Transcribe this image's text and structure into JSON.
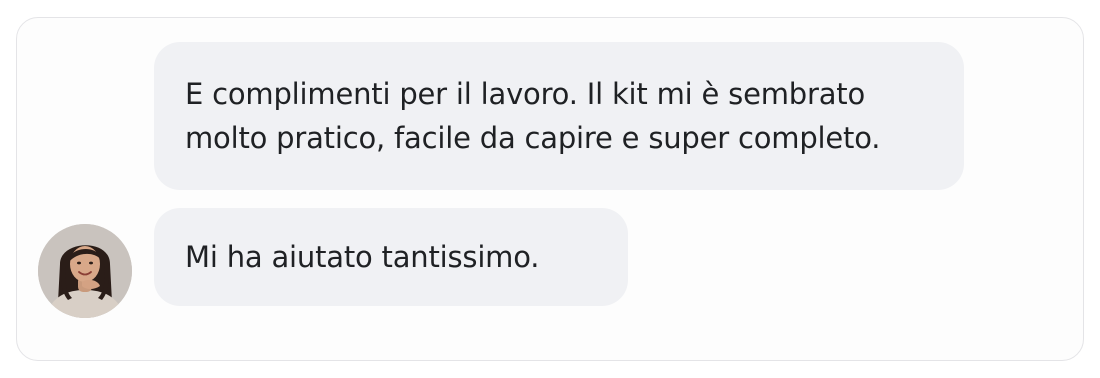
{
  "messages": [
    {
      "lines": [
        "E complimenti per il lavoro. Il kit mi è sembrato",
        "molto pratico, facile da capire e super completo."
      ]
    },
    {
      "lines": [
        "Mi ha aiutato tantissimo."
      ]
    }
  ],
  "avatar": {
    "icon": "user-avatar-photo"
  },
  "colors": {
    "bubble_background": "#f0f1f4",
    "card_border": "#e4e4e7",
    "text": "#1f2124"
  }
}
